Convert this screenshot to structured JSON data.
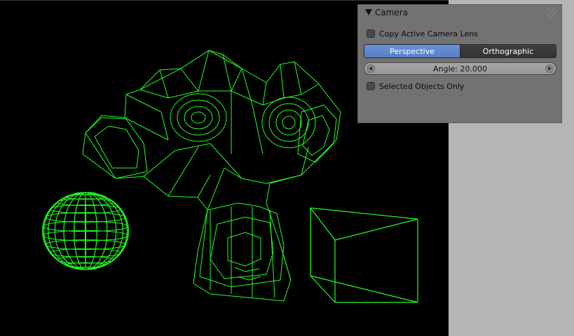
{
  "viewport": {
    "background": "#000000",
    "wire_color": "#22ff22",
    "objects": [
      "monkey-wireframe",
      "uv-sphere-wireframe",
      "cube-wireframe"
    ]
  },
  "panel": {
    "title": "Camera",
    "copy_lens_label": "Copy Active Camera Lens",
    "copy_lens_checked": false,
    "projection": {
      "options": [
        "Perspective",
        "Orthographic"
      ],
      "selected": "Perspective"
    },
    "angle_label": "Angle: 20.000",
    "selected_only_label": "Selected Objects Only",
    "selected_only_checked": false
  },
  "colors": {
    "panel_bg": "#727272",
    "accent": "#5a86cf",
    "margin_bg": "#b5b5b5"
  }
}
